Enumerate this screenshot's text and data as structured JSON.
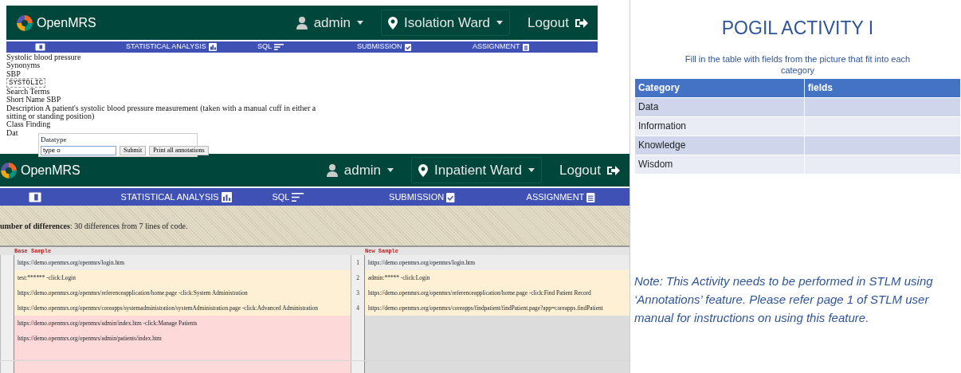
{
  "screens": [
    {
      "brand": "OpenMRS",
      "user": "admin",
      "location": "Isolation Ward",
      "logout": "Logout",
      "nav": [
        "STATISTICAL ANALYSIS",
        "SQL",
        "SUBMISSION",
        "ASSIGNMENT"
      ],
      "concept_lines": [
        {
          "kind": "text",
          "text": "Systolic blood pressure"
        },
        {
          "kind": "text",
          "text": "Synonyms"
        },
        {
          "kind": "text",
          "text": "SBP"
        },
        {
          "kind": "code",
          "text": "SYSTOLIC"
        },
        {
          "kind": "text",
          "text": "Search Terms"
        },
        {
          "kind": "text",
          "text": "Short Name SBP"
        },
        {
          "kind": "text",
          "text": "Description A patient's systolic blood pressure measurement (taken with a manual cuff in either a sitting or standing position)"
        },
        {
          "kind": "text",
          "text": "Class Finding"
        },
        {
          "kind": "text",
          "text": "Dat"
        }
      ],
      "annotation_popup": {
        "label": "Datatype",
        "value": "type o",
        "buttons": [
          "Submit",
          "Print all annotations"
        ]
      }
    },
    {
      "brand": "OpenMRS",
      "user": "admin",
      "location": "Inpatient Ward",
      "logout": "Logout",
      "nav": [
        "STATISTICAL ANALYSIS",
        "SQL",
        "SUBMISSION",
        "ASSIGNMENT"
      ],
      "summary": "**umber of differences**: 30 differences from 7 lines of code.",
      "diff": {
        "base_heading": "Base Sample",
        "new_heading": "New Sample",
        "rows": [
          {
            "changed": false,
            "removed": false,
            "line": "1",
            "base": "https://demo.openmrs.org/openmrs/login.htm",
            "new": "https://demo.openmrs.org/openmrs/login.htm"
          },
          {
            "changed": true,
            "removed": false,
            "line": "2",
            "base": "test:****** -click:Login",
            "new": "admin:***** -click:Login"
          },
          {
            "changed": true,
            "removed": false,
            "line": "3",
            "base": "https://demo.openmrs.org/openmrs/referenceapplication/home.page -click:System Administration",
            "new": "https://demo.openmrs.org/openmrs/referenceapplication/home.page -click:Find Patient Record"
          },
          {
            "changed": true,
            "removed": false,
            "line": "4",
            "base": "https://demo.openmrs.org/openmrs/coreapps/systemadministration/systemAdministration.page -click:Advanced Administration",
            "new": "https://demo.openmrs.org/openmrs/coreapps/findpatient/findPatient.page?app=coreapps.findPatient"
          },
          {
            "changed": false,
            "removed": true,
            "base": "https://demo.openmrs.org/openmrs/admin/index.htm -click:Manage Patients"
          },
          {
            "changed": false,
            "removed": true,
            "base": "https://demo.openmrs.org/openmrs/admin/patients/index.htm"
          },
          {
            "changed": false,
            "removed": true
          },
          {
            "changed": false,
            "removed": true
          }
        ]
      }
    }
  ],
  "slide": {
    "title": "POGIL ACTIVITY I",
    "instruction": "Fill in the table with fields from the picture that fit into each category",
    "table": {
      "columns": [
        "Category",
        "fields"
      ],
      "rows": [
        "Data",
        "Information",
        "Knowledge",
        "Wisdom"
      ]
    },
    "note": "Note: This Activity needs to be performed in STLM using ‘Annotations’ feature. Please refer page 1 of STLM user manual for instructions on using this feature."
  }
}
